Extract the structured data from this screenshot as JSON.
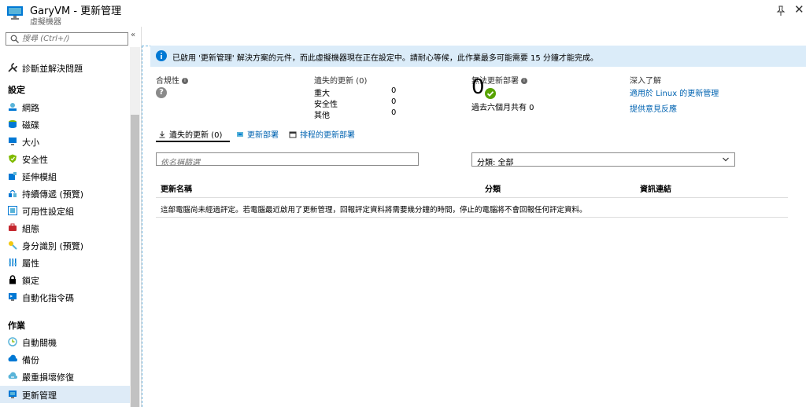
{
  "window": {
    "title": "GaryVM - 更新管理",
    "subtitle": "虛擬機器"
  },
  "sidebar": {
    "search_placeholder": "搜尋 (Ctrl+/)",
    "top_item": "診斷並解決問題",
    "section_settings": "設定",
    "settings_items": [
      {
        "label": "網路",
        "icon": "network-icon"
      },
      {
        "label": "磁碟",
        "icon": "disk-icon"
      },
      {
        "label": "大小",
        "icon": "size-icon"
      },
      {
        "label": "安全性",
        "icon": "security-shield-icon"
      },
      {
        "label": "延伸模組",
        "icon": "extensions-icon"
      },
      {
        "label": "持續傳遞 (預覽)",
        "icon": "continuous-delivery-icon"
      },
      {
        "label": "可用性設定組",
        "icon": "availability-set-icon"
      },
      {
        "label": "組態",
        "icon": "configuration-icon"
      },
      {
        "label": "身分識別 (預覽)",
        "icon": "identity-key-icon"
      },
      {
        "label": "屬性",
        "icon": "properties-icon"
      },
      {
        "label": "鎖定",
        "icon": "lock-icon"
      },
      {
        "label": "自動化指令碼",
        "icon": "automation-script-icon"
      }
    ],
    "section_operations": "作業",
    "operations_items": [
      {
        "label": "自動關機",
        "icon": "auto-shutdown-icon"
      },
      {
        "label": "備份",
        "icon": "backup-icon"
      },
      {
        "label": "嚴重損壞修復",
        "icon": "disaster-recovery-icon"
      },
      {
        "label": "更新管理",
        "icon": "update-management-icon"
      }
    ]
  },
  "banner": {
    "text": "已啟用 '更新管理' 解決方案的元件，而此虛擬機器現在正在設定中。請耐心等候，此作業最多可能需要 15 分鐘才能完成。"
  },
  "summary": {
    "compliance_label": "合規性",
    "missing_label": "遺失的更新 (0)",
    "missing_rows": [
      {
        "name": "重大",
        "count": "0"
      },
      {
        "name": "安全性",
        "count": "0"
      },
      {
        "name": "其他",
        "count": "0"
      }
    ],
    "failed_label": "無法更新部署",
    "failed_count": "0",
    "failed_note": "過去六個月共有 0",
    "learn_more_label": "深入了解",
    "learn_links": [
      "適用於 Linux 的更新管理",
      "提供意見反應"
    ]
  },
  "tabs": [
    {
      "label": "遺失的更新 (0)",
      "icon": "download-arrow-icon",
      "active": true
    },
    {
      "label": "更新部署",
      "icon": "deploy-icon",
      "active": false
    },
    {
      "label": "排程的更新部署",
      "icon": "calendar-icon",
      "active": false
    }
  ],
  "filter": {
    "placeholder": "依名稱篩選",
    "classification_value": "分類: 全部"
  },
  "table": {
    "columns": [
      "更新名稱",
      "分類",
      "資訊連結"
    ],
    "message": "這部電腦尚未經過評定。若電腦最近啟用了更新管理，回報評定資料將需要幾分鐘的時間，停止的電腦將不會回報任何評定資料。"
  },
  "colors": {
    "accent": "#0078d4",
    "banner_bg": "#dbecf9",
    "selected_nav_bg": "#deebf7",
    "success_green": "#57a300"
  }
}
